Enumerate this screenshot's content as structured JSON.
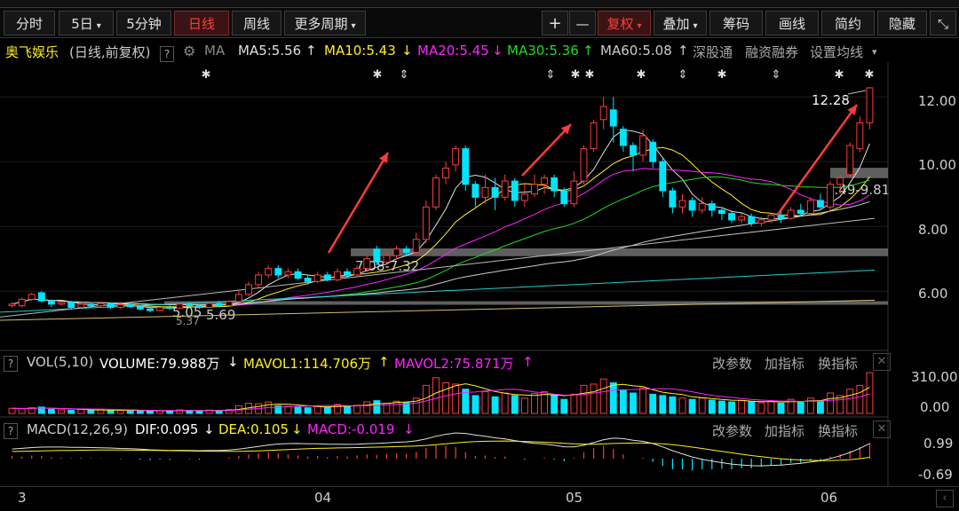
{
  "colors": {
    "up": "#ff3b3b",
    "down": "#00e5ff",
    "ma5": "#e0e0e0",
    "ma10": "#ffee22",
    "ma20": "#ff22ff",
    "ma30": "#22dd22",
    "ma60": "#cccccc",
    "support": "#777777"
  },
  "toolbar": {
    "buttons": [
      {
        "label": "分时"
      },
      {
        "label": "5日",
        "dropdown": true
      },
      {
        "label": "5分钟"
      },
      {
        "label": "日线",
        "active": true
      },
      {
        "label": "周线"
      },
      {
        "label": "更多周期",
        "dropdown": true
      }
    ],
    "right": [
      {
        "label": "+"
      },
      {
        "label": "—"
      },
      {
        "label": "复权",
        "dropdown": true,
        "active": true
      },
      {
        "label": "叠加",
        "dropdown": true
      },
      {
        "label": "筹码"
      },
      {
        "label": "画线"
      },
      {
        "label": "简约"
      },
      {
        "label": "隐藏"
      },
      {
        "label": "⤡"
      }
    ]
  },
  "info": {
    "stock_name": "奥飞娱乐",
    "period_note": "(日线,前复权)",
    "q": "?",
    "ma_label": "MA",
    "ma5": "MA5:5.56",
    "ma10": "MA10:5.43",
    "ma20": "MA20:5.45",
    "ma30": "MA30:5.36",
    "ma60": "MA60:5.08",
    "links": [
      "深股通",
      "融资融券",
      "设置均线"
    ]
  },
  "main_chart": {
    "y_ticks": [
      "12.00",
      "10.00",
      "8.00",
      "6.00"
    ],
    "annotations": {
      "high": "12.28",
      "zone1": "9.49-9.81",
      "zone2": "7.08-7.32",
      "zone3": "5.05",
      "zone3b": "5.69",
      "low_label": "5.37"
    }
  },
  "vol_panel": {
    "q": "?",
    "title": "VOL(5,10)",
    "volume": "VOLUME:79.988万",
    "mavol1": "MAVOL1:114.706万",
    "mavol2": "MAVOL2:75.871万",
    "y_ticks": [
      "310.00",
      "0.00"
    ],
    "links": [
      "改参数",
      "加指标",
      "换指标"
    ]
  },
  "macd_panel": {
    "q": "?",
    "title": "MACD(12,26,9)",
    "dif": "DIF:0.095",
    "dea": "DEA:0.105",
    "macd": "MACD:-0.019",
    "y_ticks": [
      "0.99",
      "-0.69"
    ],
    "links": [
      "改参数",
      "加指标",
      "换指标"
    ]
  },
  "x_axis": {
    "labels": [
      "3",
      "04",
      "05",
      "06"
    ]
  },
  "chart_data": {
    "type": "candlestick",
    "title": "奥飞娱乐",
    "ylim": [
      4.8,
      12.8
    ],
    "candles": [
      [
        5.55,
        5.6,
        5.5,
        5.65
      ],
      [
        5.55,
        5.75,
        5.5,
        5.8
      ],
      [
        5.75,
        5.9,
        5.7,
        5.95
      ],
      [
        5.95,
        5.7,
        5.65,
        6.0
      ],
      [
        5.7,
        5.6,
        5.5,
        5.75
      ],
      [
        5.6,
        5.65,
        5.55,
        5.7
      ],
      [
        5.65,
        5.5,
        5.45,
        5.7
      ],
      [
        5.5,
        5.6,
        5.45,
        5.65
      ],
      [
        5.6,
        5.55,
        5.5,
        5.65
      ],
      [
        5.55,
        5.62,
        5.5,
        5.68
      ],
      [
        5.62,
        5.5,
        5.45,
        5.65
      ],
      [
        5.5,
        5.58,
        5.45,
        5.62
      ],
      [
        5.58,
        5.52,
        5.48,
        5.62
      ],
      [
        5.52,
        5.45,
        5.4,
        5.56
      ],
      [
        5.45,
        5.4,
        5.35,
        5.5
      ],
      [
        5.4,
        5.5,
        5.38,
        5.55
      ],
      [
        5.5,
        5.48,
        5.42,
        5.56
      ],
      [
        5.48,
        5.6,
        5.45,
        5.64
      ],
      [
        5.6,
        5.55,
        5.5,
        5.66
      ],
      [
        5.55,
        5.5,
        5.45,
        5.6
      ],
      [
        5.5,
        5.62,
        5.48,
        5.68
      ],
      [
        5.62,
        5.55,
        5.5,
        5.7
      ],
      [
        5.55,
        5.68,
        5.52,
        5.72
      ],
      [
        5.68,
        5.9,
        5.65,
        6.0
      ],
      [
        5.9,
        6.2,
        5.85,
        6.3
      ],
      [
        6.2,
        6.5,
        6.1,
        6.6
      ],
      [
        6.5,
        6.7,
        6.4,
        6.8
      ],
      [
        6.7,
        6.5,
        6.4,
        6.8
      ],
      [
        6.5,
        6.6,
        6.4,
        6.7
      ],
      [
        6.6,
        6.4,
        6.35,
        6.7
      ],
      [
        6.4,
        6.3,
        6.2,
        6.5
      ],
      [
        6.3,
        6.5,
        6.25,
        6.6
      ],
      [
        6.5,
        6.35,
        6.3,
        6.6
      ],
      [
        6.35,
        6.6,
        6.3,
        6.7
      ],
      [
        6.6,
        6.5,
        6.4,
        6.7
      ],
      [
        6.5,
        6.7,
        6.45,
        6.8
      ],
      [
        6.7,
        7.0,
        6.6,
        7.1
      ],
      [
        7.3,
        6.9,
        6.8,
        7.4
      ],
      [
        6.9,
        7.1,
        6.85,
        7.2
      ],
      [
        7.1,
        7.3,
        7.0,
        7.4
      ],
      [
        7.3,
        7.2,
        7.1,
        7.4
      ],
      [
        7.2,
        7.6,
        7.15,
        7.8
      ],
      [
        7.6,
        8.6,
        7.5,
        8.8
      ],
      [
        8.6,
        9.5,
        8.5,
        9.6
      ],
      [
        9.5,
        9.8,
        9.3,
        10.0
      ],
      [
        9.9,
        10.4,
        9.7,
        10.5
      ],
      [
        10.4,
        9.3,
        9.1,
        10.5
      ],
      [
        9.3,
        8.9,
        8.6,
        9.4
      ],
      [
        8.9,
        9.2,
        8.7,
        9.6
      ],
      [
        9.2,
        8.9,
        8.5,
        9.5
      ],
      [
        8.9,
        9.4,
        8.8,
        9.6
      ],
      [
        9.4,
        8.8,
        8.6,
        9.5
      ],
      [
        8.8,
        9.0,
        8.6,
        9.3
      ],
      [
        9.0,
        9.3,
        8.9,
        9.6
      ],
      [
        9.3,
        9.5,
        9.0,
        9.6
      ],
      [
        9.5,
        9.1,
        8.9,
        9.6
      ],
      [
        9.1,
        8.7,
        8.6,
        9.2
      ],
      [
        8.7,
        9.4,
        8.6,
        9.7
      ],
      [
        9.4,
        10.4,
        9.3,
        10.5
      ],
      [
        10.4,
        11.2,
        10.3,
        11.3
      ],
      [
        11.3,
        11.7,
        11.0,
        12.0
      ],
      [
        11.6,
        11.1,
        10.6,
        12.0
      ],
      [
        11.0,
        10.5,
        10.3,
        11.1
      ],
      [
        10.5,
        10.2,
        9.7,
        10.6
      ],
      [
        10.2,
        10.8,
        10.0,
        11.0
      ],
      [
        10.6,
        10.0,
        9.8,
        10.7
      ],
      [
        10.0,
        9.1,
        8.9,
        10.1
      ],
      [
        9.1,
        8.6,
        8.4,
        9.2
      ],
      [
        8.6,
        8.8,
        8.4,
        9.0
      ],
      [
        8.8,
        8.5,
        8.3,
        8.9
      ],
      [
        8.5,
        8.7,
        8.4,
        8.9
      ],
      [
        8.7,
        8.5,
        8.3,
        8.8
      ],
      [
        8.5,
        8.4,
        8.2,
        8.6
      ],
      [
        8.4,
        8.2,
        8.1,
        8.5
      ],
      [
        8.2,
        8.3,
        8.1,
        8.4
      ],
      [
        8.3,
        8.1,
        8.0,
        8.4
      ],
      [
        8.1,
        8.2,
        8.0,
        8.3
      ],
      [
        8.2,
        8.35,
        8.1,
        8.4
      ],
      [
        8.35,
        8.25,
        8.1,
        8.5
      ],
      [
        8.25,
        8.5,
        8.2,
        8.6
      ],
      [
        8.5,
        8.4,
        8.3,
        8.7
      ],
      [
        8.4,
        8.8,
        8.35,
        8.9
      ],
      [
        8.8,
        8.6,
        8.5,
        9.0
      ],
      [
        8.6,
        9.3,
        8.5,
        9.4
      ],
      [
        9.3,
        9.5,
        9.0,
        9.6
      ],
      [
        9.6,
        10.5,
        9.5,
        10.6
      ],
      [
        10.4,
        11.2,
        10.3,
        11.4
      ],
      [
        11.2,
        12.28,
        11.0,
        12.3
      ]
    ],
    "volume": [
      20,
      18,
      22,
      25,
      16,
      14,
      12,
      15,
      13,
      14,
      12,
      11,
      12,
      10,
      9,
      11,
      10,
      14,
      12,
      10,
      13,
      11,
      15,
      30,
      40,
      38,
      45,
      30,
      28,
      25,
      22,
      30,
      24,
      35,
      28,
      32,
      45,
      50,
      40,
      48,
      42,
      60,
      110,
      140,
      120,
      115,
      95,
      70,
      85,
      65,
      80,
      70,
      60,
      78,
      85,
      70,
      55,
      75,
      110,
      115,
      135,
      120,
      90,
      80,
      100,
      75,
      70,
      65,
      60,
      55,
      60,
      52,
      48,
      45,
      50,
      45,
      42,
      48,
      40,
      55,
      45,
      60,
      50,
      80,
      70,
      95,
      110,
      160
    ],
    "macd_hist": [
      0.05,
      0.04,
      0.06,
      0.05,
      0.03,
      0.02,
      0.01,
      0.02,
      0.01,
      0.01,
      0.0,
      -0.01,
      0.0,
      -0.02,
      -0.03,
      -0.02,
      -0.02,
      0.0,
      -0.01,
      -0.02,
      0.0,
      0.0,
      0.02,
      0.05,
      0.08,
      0.1,
      0.12,
      0.1,
      0.08,
      0.06,
      0.04,
      0.05,
      0.03,
      0.05,
      0.04,
      0.06,
      0.08,
      0.07,
      0.09,
      0.1,
      0.09,
      0.13,
      0.2,
      0.25,
      0.24,
      0.22,
      0.12,
      0.05,
      0.06,
      0.03,
      0.04,
      0.0,
      -0.02,
      0.0,
      0.02,
      -0.02,
      -0.05,
      0.02,
      0.12,
      0.2,
      0.24,
      0.18,
      0.08,
      0.0,
      0.02,
      -0.06,
      -0.14,
      -0.2,
      -0.2,
      -0.22,
      -0.2,
      -0.2,
      -0.19,
      -0.2,
      -0.18,
      -0.18,
      -0.15,
      -0.12,
      -0.12,
      -0.08,
      -0.08,
      -0.04,
      -0.04,
      0.04,
      0.08,
      0.15,
      0.22,
      0.3
    ]
  }
}
